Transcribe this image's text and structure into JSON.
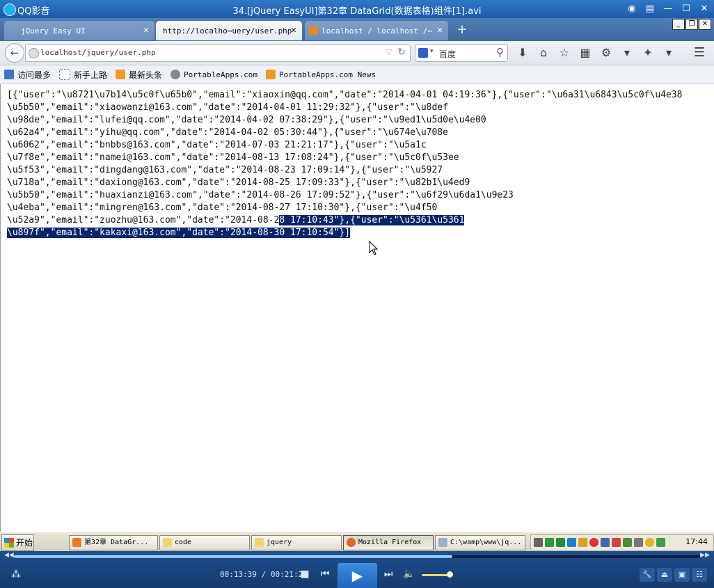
{
  "player": {
    "app_name": "QQ影音",
    "file_title": "34.[jQuery EasyUI]第32章 DataGrid(数据表格)组件[1].avi",
    "time_current": "00:13:39",
    "time_total": "00:21:21",
    "progress": 0.639,
    "volume": 0.8
  },
  "browser": {
    "tabs": [
      {
        "label": "jQuery Easy UI"
      },
      {
        "label": "http://localho⋯uery/user.php"
      },
      {
        "label": "localhost / localhost /⋯"
      }
    ],
    "url": "localhost/jquery/user.php",
    "search_placeholder": "百度",
    "bookmarks": [
      {
        "label": "访问最多"
      },
      {
        "label": "新手上路"
      },
      {
        "label": "最新头条"
      },
      {
        "label": "PortableApps.com"
      },
      {
        "label": "PortableApps.com News"
      }
    ]
  },
  "content": {
    "lines": [
      "[{\"user\":\"\\u8721\\u7b14\\u5c0f\\u65b0\",\"email\":\"xiaoxin@qq.com\",\"date\":\"2014-04-01 04:19:36\"},{\"user\":\"\\u6a31\\u6843\\u5c0f\\u4e38",
      "\\u5b50\",\"email\":\"xiaowanzi@163.com\",\"date\":\"2014-04-01 11:29:32\"},{\"user\":\"\\u8def",
      "\\u98de\",\"email\":\"lufei@qq.com\",\"date\":\"2014-04-02 07:38:29\"},{\"user\":\"\\u9ed1\\u5d0e\\u4e00",
      "\\u62a4\",\"email\":\"yihu@qq.com\",\"date\":\"2014-04-02 05:30:44\"},{\"user\":\"\\u674e\\u708e",
      "\\u6062\",\"email\":\"bnbbs@163.com\",\"date\":\"2014-07-03 21:21:17\"},{\"user\":\"\\u5a1c",
      "\\u7f8e\",\"email\":\"namei@163.com\",\"date\":\"2014-08-13 17:08:24\"},{\"user\":\"\\u5c0f\\u53ee",
      "\\u5f53\",\"email\":\"dingdang@163.com\",\"date\":\"2014-08-23 17:09:14\"},{\"user\":\"\\u5927",
      "\\u718a\",\"email\":\"daxiong@163.com\",\"date\":\"2014-08-25 17:09:33\"},{\"user\":\"\\u82b1\\u4ed9",
      "\\u5b50\",\"email\":\"huaxianzi@163.com\",\"date\":\"2014-08-26 17:09:52\"},{\"user\":\"\\u6f29\\u6da1\\u9e23",
      "\\u4eba\",\"email\":\"mingren@163.com\",\"date\":\"2014-08-27 17:10:30\"},{\"user\":\"\\u4f50"
    ],
    "line10_plain": "\\u52a9\",\"email\":\"zuozhu@163.com\",\"date\":\"2014-08-2",
    "line10_selected": "8 17:10:43\"},{\"user\":\"\\u5361\\u5361",
    "line11_selected": "\\u897f\",\"email\":\"kakaxi@163.com\",\"date\":\"2014-08-30 17:10:54\"}]"
  },
  "taskbar": {
    "start_label": "开始",
    "tasks": [
      {
        "label": "第32章 DataGr..."
      },
      {
        "label": "code"
      },
      {
        "label": "jquery"
      },
      {
        "label": "Mozilla Firefox"
      },
      {
        "label": "C:\\wamp\\www\\jq..."
      }
    ],
    "clock": "17:44"
  },
  "colors": {
    "selection": "#0a246a",
    "player_bg": "#1b3a6b",
    "play_button": "#2d7ad0"
  }
}
